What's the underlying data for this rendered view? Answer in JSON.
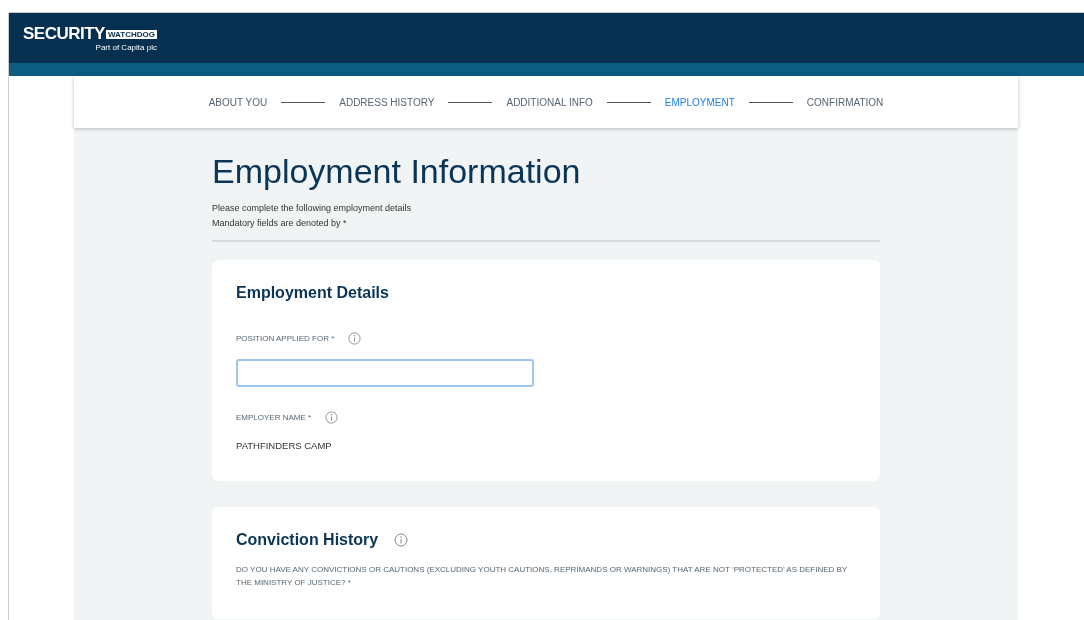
{
  "header": {
    "logo": {
      "word": "SECURITY",
      "badge": "WATCHDOG",
      "tagline": "Part of Capita plc"
    }
  },
  "steps": [
    {
      "label": "ABOUT YOU",
      "selected": false
    },
    {
      "label": "ADDRESS HISTORY",
      "selected": false
    },
    {
      "label": "ADDITIONAL INFO",
      "selected": false
    },
    {
      "label": "EMPLOYMENT",
      "selected": true
    },
    {
      "label": "CONFIRMATION",
      "selected": false
    }
  ],
  "page": {
    "title": "Employment Information",
    "intro": [
      "Please complete the following employment details",
      "Mandatory fields are denoted by *"
    ]
  },
  "sections": [
    {
      "title": "Employment Details",
      "info": false,
      "fields": [
        {
          "kind": "input",
          "label": "POSITION APPLIED FOR *",
          "focused": true
        },
        {
          "kind": "value",
          "label": "EMPLOYER NAME *",
          "value": "PATHFINDERS CAMP"
        }
      ]
    },
    {
      "title": "Conviction History",
      "info": true,
      "question": "DO YOU HAVE ANY CONVICTIONS OR CAUTIONS (EXCLUDING YOUTH CAUTIONS, REPRIMANDS OR WARNINGS) THAT ARE NOT ‘PROTECTED’ AS DEFINED BY THE MINISTRY OF JUSTICE? *"
    }
  ]
}
